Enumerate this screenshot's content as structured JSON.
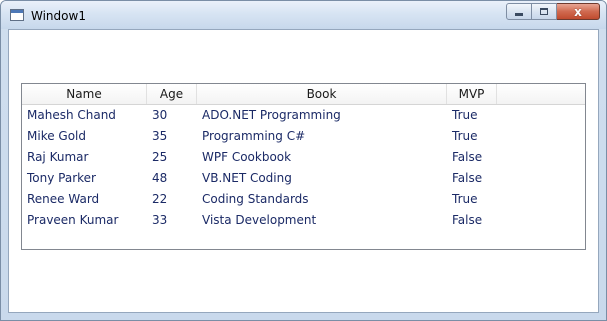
{
  "window": {
    "title": "Window1"
  },
  "caption": {
    "close_glyph": "x"
  },
  "grid": {
    "columns": [
      "Name",
      "Age",
      "Book",
      "MVP"
    ],
    "rows": [
      [
        "Mahesh Chand",
        "30",
        "ADO.NET Programming",
        "True"
      ],
      [
        "Mike Gold",
        "35",
        "Programming C#",
        "True"
      ],
      [
        "Raj Kumar",
        "25",
        "WPF Cookbook",
        "False"
      ],
      [
        "Tony Parker",
        "48",
        "VB.NET Coding",
        "False"
      ],
      [
        "Renee Ward",
        "22",
        "Coding Standards",
        "True"
      ],
      [
        "Praveen Kumar",
        "33",
        "Vista Development",
        "False"
      ]
    ]
  }
}
